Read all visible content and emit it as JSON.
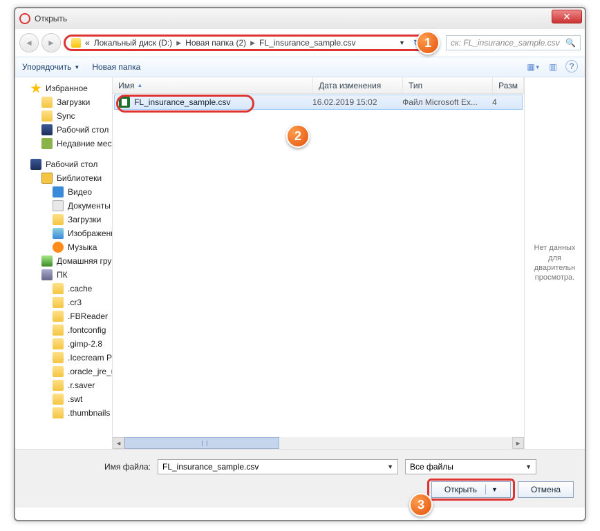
{
  "title": "Открыть",
  "breadcrumb": {
    "root_marker": "«",
    "seg1": "Локальный диск (D:)",
    "seg2": "Новая папка (2)",
    "seg3": "FL_insurance_sample.csv"
  },
  "search": {
    "placeholder": "ск: FL_insurance_sample.csv"
  },
  "toolbar": {
    "organize": "Упорядочить",
    "newfolder": "Новая папка"
  },
  "tree": {
    "favorites": "Избранное",
    "downloads": "Загрузки",
    "sync": "Sync",
    "desktop": "Рабочий стол",
    "recent": "Недавние места",
    "desktop2": "Рабочий стол",
    "libs": "Библиотеки",
    "video": "Видео",
    "docs": "Документы",
    "downloads2": "Загрузки",
    "images": "Изображения",
    "music": "Музыка",
    "homegroup": "Домашняя группа",
    "pc": "ПК",
    "f1": ".cache",
    "f2": ".cr3",
    "f3": ".FBReader",
    "f4": ".fontconfig",
    "f5": ".gimp-2.8",
    "f6": ".Icecream PDF Co",
    "f7": ".oracle_jre_usage",
    "f8": ".r.saver",
    "f9": ".swt",
    "f10": ".thumbnails"
  },
  "columns": {
    "name": "Имя",
    "date": "Дата изменения",
    "type": "Тип",
    "size": "Разм"
  },
  "file": {
    "name": "FL_insurance_sample.csv",
    "date": "16.02.2019 15:02",
    "type": "Файл Microsoft Ex...",
    "size": "4"
  },
  "preview": "Нет данных для дварительн просмотра.",
  "footer": {
    "fname_label": "Имя файла:",
    "fname_value": "FL_insurance_sample.csv",
    "ftype_value": "Все файлы",
    "open": "Открыть",
    "cancel": "Отмена"
  },
  "badges": {
    "b1": "1",
    "b2": "2",
    "b3": "3"
  }
}
